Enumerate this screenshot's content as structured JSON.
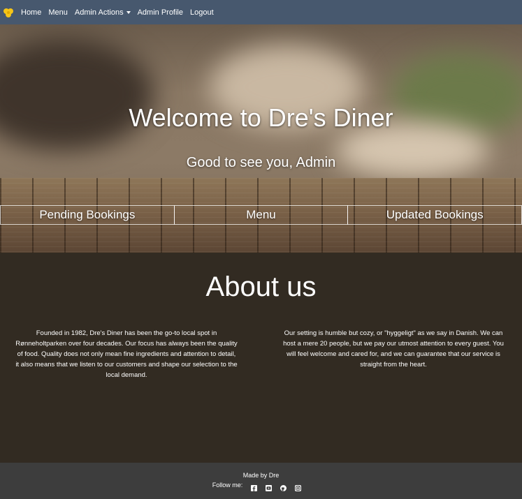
{
  "nav": {
    "home": "Home",
    "menu": "Menu",
    "admin_actions": "Admin Actions",
    "admin_profile": "Admin Profile",
    "logout": "Logout"
  },
  "hero": {
    "title": "Welcome to Dre's Diner",
    "subtitle": "Good to see you, Admin",
    "buttons": [
      "Pending Bookings",
      "Menu",
      "Updated Bookings"
    ]
  },
  "about": {
    "title": "About us",
    "left_text": "Founded in 1982, Dre's Diner has been the go-to local spot in Rønneholtparken over four decades. Our focus has always been the quality of food. Quality does not only mean fine ingredients and attention to detail, it also means that we listen to our customers and shape our selection to the local demand.",
    "right_text": "Our setting is humble but cozy, or \"hyggeligt\" as we say in Danish. We can host a mere 20 people, but we pay our utmost attention to every guest. You will feel welcome and cared for, and we can guarantee that our service is straight from the heart."
  },
  "footer": {
    "made_by": "Made by Dre",
    "follow_me": "Follow me:",
    "social_icons": [
      "facebook-icon",
      "youtube-icon",
      "github-icon",
      "instagram-icon"
    ]
  },
  "colors": {
    "navbar": "#47586e",
    "about_bg": "#322b22",
    "footer_bg": "#3d3d3d",
    "brand_yellow": "#f5c518"
  }
}
